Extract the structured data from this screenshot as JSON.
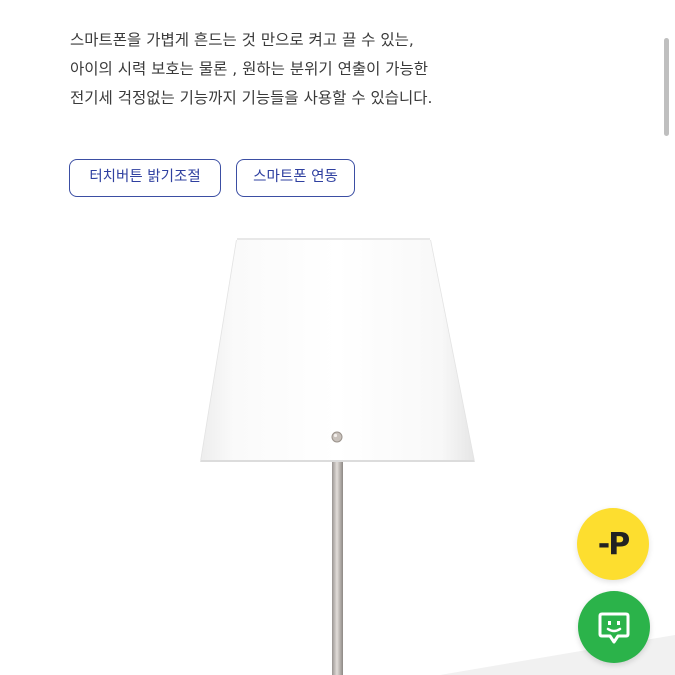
{
  "description": {
    "line1": "스마트폰을 가볍게 흔드는 것 만으로 켜고 끌 수 있는,",
    "line2": "아이의 시력 보호는 물론 , 원하는 분위기 연출이 가능한",
    "line3": "전기세 걱정없는 기능까지 기능들을 사용할 수 있습니다."
  },
  "tags": [
    {
      "label": "터치버튼 밝기조절"
    },
    {
      "label": "스마트폰 연동"
    }
  ],
  "product_image": {
    "subject": "floor-lamp-white-shade"
  },
  "floating_buttons": {
    "point": {
      "icon": "point-p-icon",
      "glyph": "-P",
      "color": "#fdde2f"
    },
    "chat": {
      "icon": "chat-icon",
      "color": "#2bb34a"
    }
  }
}
